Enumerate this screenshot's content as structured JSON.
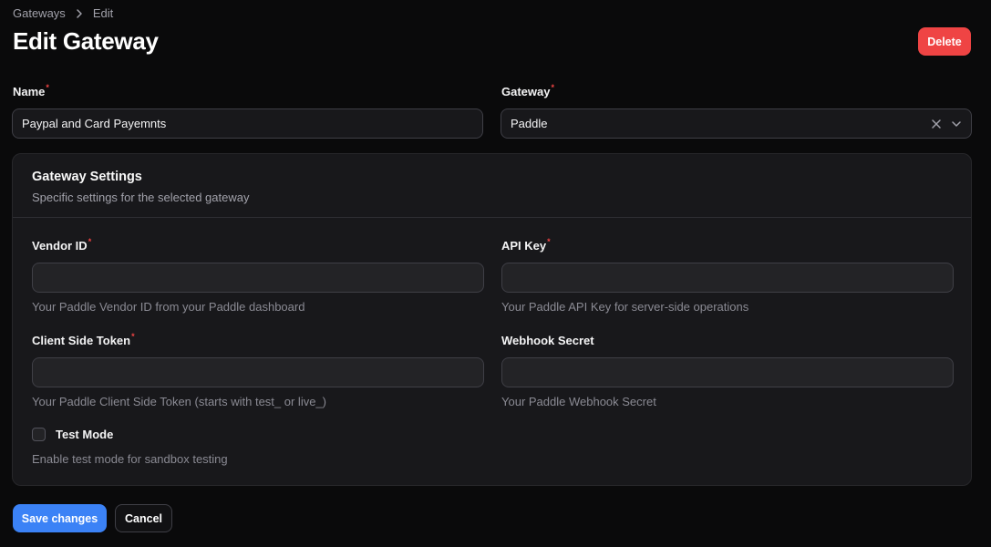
{
  "breadcrumb": {
    "items": [
      "Gateways",
      "Edit"
    ]
  },
  "header": {
    "title": "Edit Gateway",
    "delete_label": "Delete"
  },
  "form": {
    "name": {
      "label": "Name",
      "value": "Paypal and Card Payemnts"
    },
    "gateway": {
      "label": "Gateway",
      "value": "Paddle"
    }
  },
  "settings": {
    "title": "Gateway Settings",
    "description": "Specific settings for the selected gateway",
    "vendor_id": {
      "label": "Vendor ID",
      "value": "",
      "hint": "Your Paddle Vendor ID from your Paddle dashboard"
    },
    "api_key": {
      "label": "API Key",
      "value": "",
      "hint": "Your Paddle API Key for server-side operations"
    },
    "client_token": {
      "label": "Client Side Token",
      "value": "",
      "hint": "Your Paddle Client Side Token (starts with test_ or live_)"
    },
    "webhook_secret": {
      "label": "Webhook Secret",
      "value": "",
      "hint": "Your Paddle Webhook Secret"
    },
    "test_mode": {
      "label": "Test Mode",
      "hint": "Enable test mode for sandbox testing",
      "checked": false
    }
  },
  "footer": {
    "save_label": "Save changes",
    "cancel_label": "Cancel"
  },
  "colors": {
    "accent": "#3b82f6",
    "danger": "#ef4444",
    "background": "#0a0a0b",
    "card": "#18181b"
  },
  "icons": {
    "breadcrumb_separator": "chevron-right-icon",
    "clear": "close-icon",
    "dropdown": "chevron-down-icon"
  }
}
